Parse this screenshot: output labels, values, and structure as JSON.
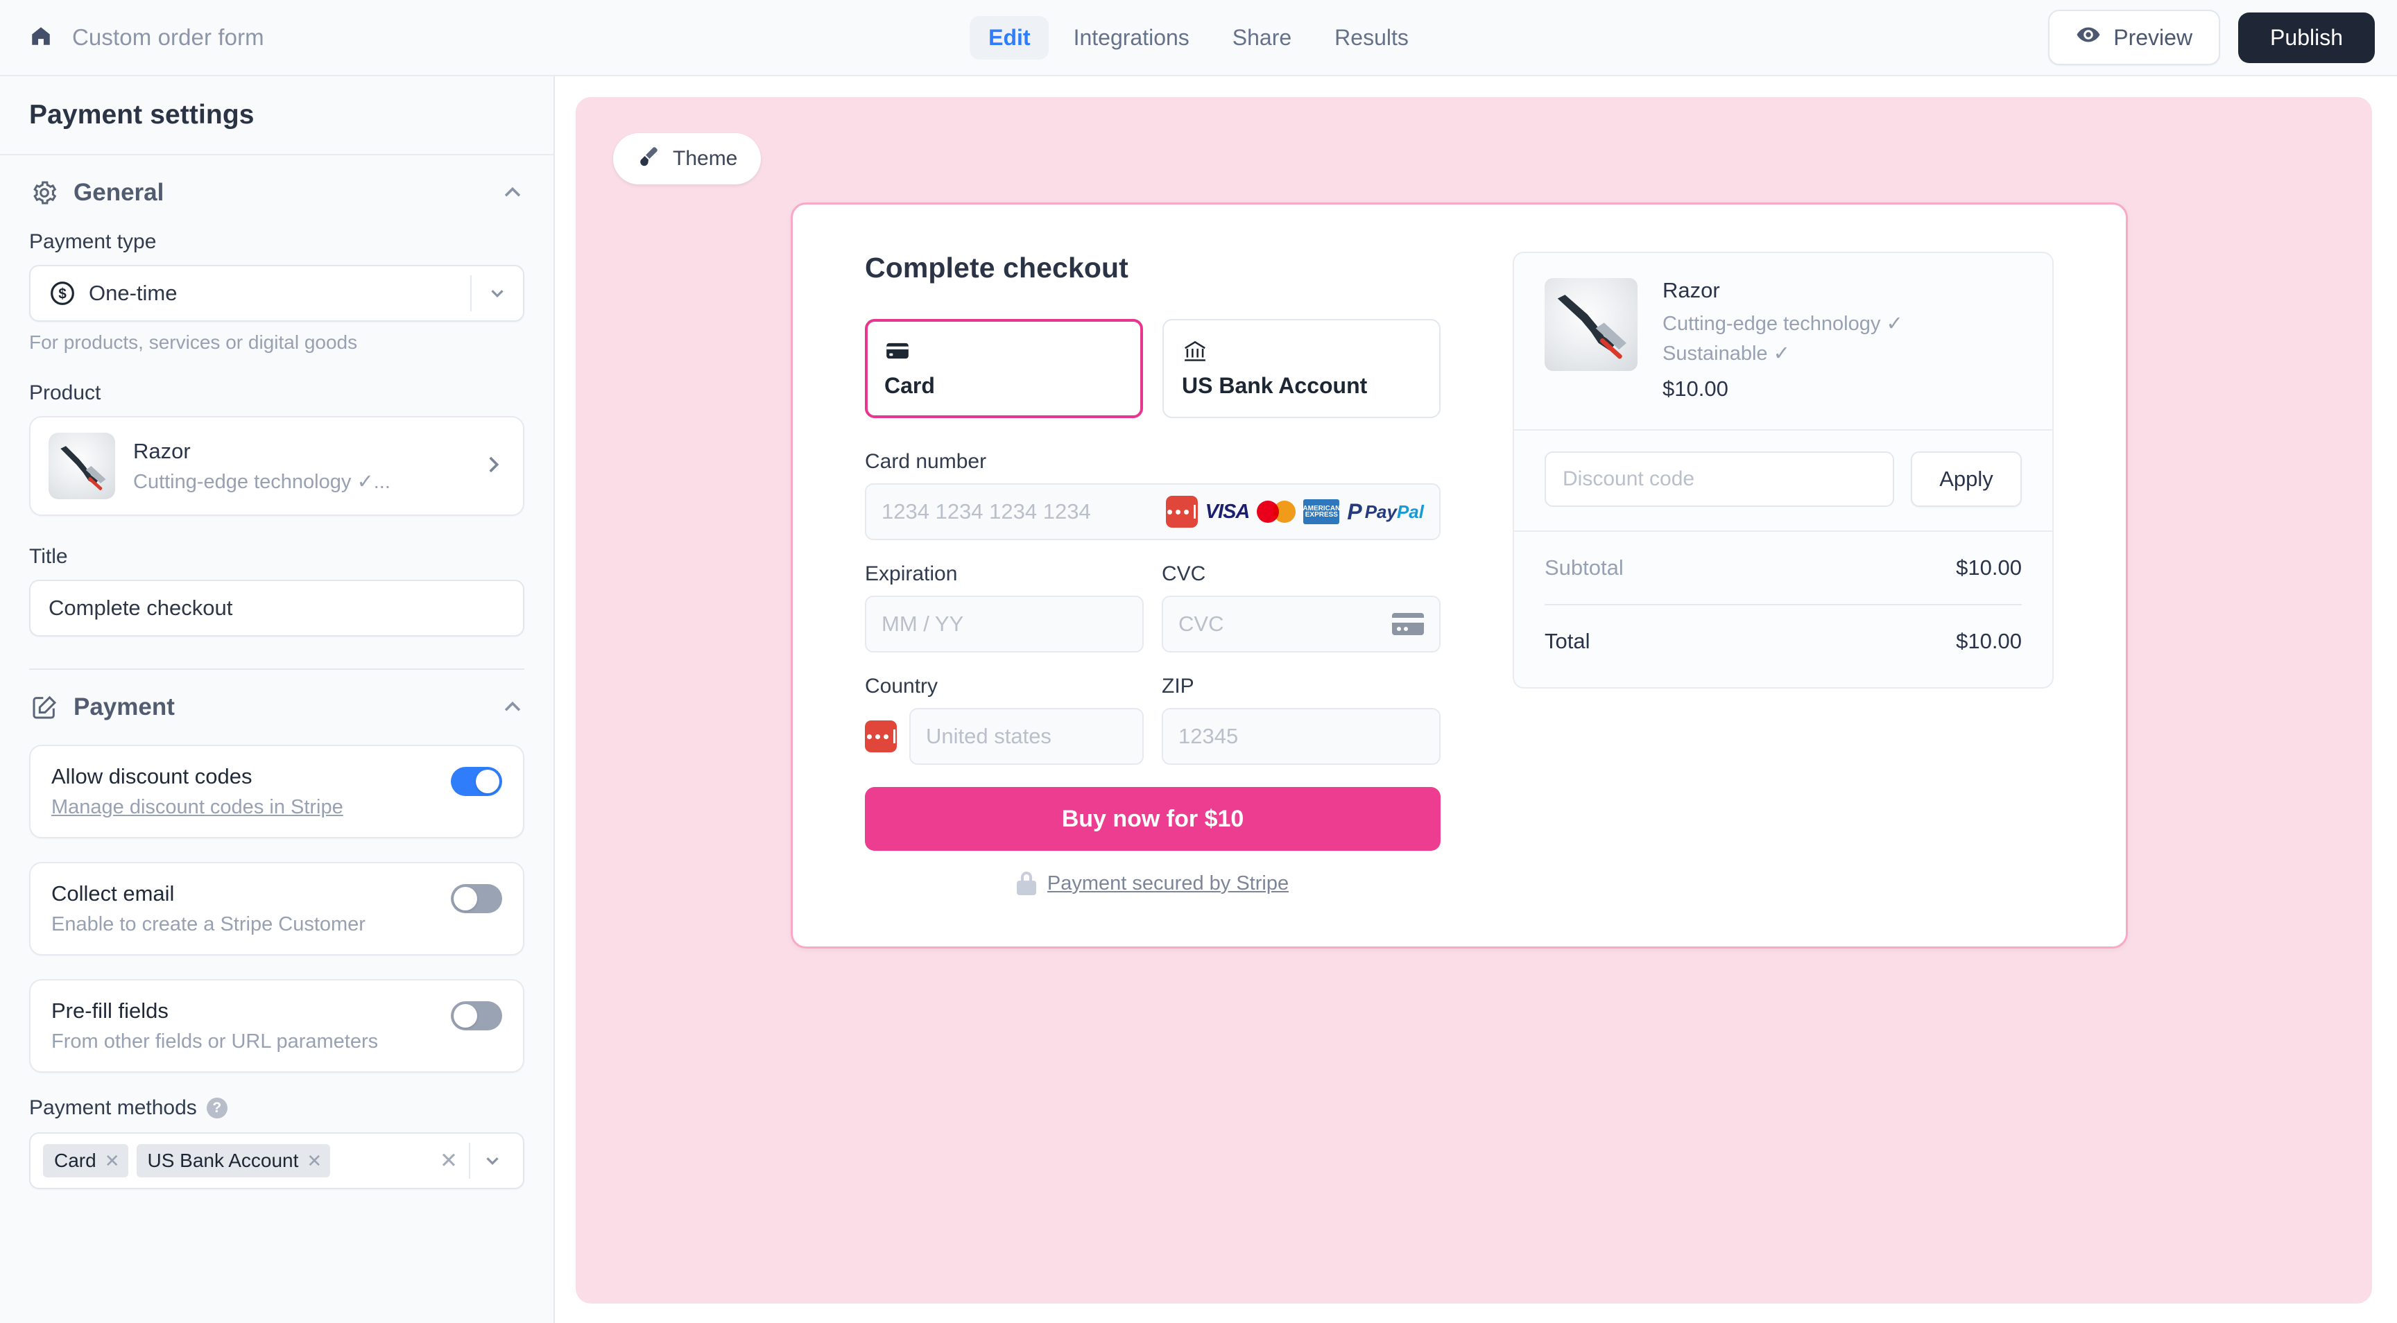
{
  "topbar": {
    "home_icon": "home-icon",
    "doc_title": "Custom order form",
    "tabs": [
      {
        "label": "Edit",
        "active": true
      },
      {
        "label": "Integrations",
        "active": false
      },
      {
        "label": "Share",
        "active": false
      },
      {
        "label": "Results",
        "active": false
      }
    ],
    "preview_label": "Preview",
    "preview_icon": "eye-icon",
    "publish_label": "Publish",
    "accent_blue": "#2f7dfb",
    "publish_bg": "#1f2736"
  },
  "sidebar": {
    "title": "Payment settings",
    "general": {
      "icon": "gear-icon",
      "title": "General",
      "collapse_icon": "chevron-up-icon",
      "payment_type_label": "Payment type",
      "payment_type_value": "One-time",
      "payment_type_icon": "dollar-circle-icon",
      "payment_type_hint": "For products, services or digital goods",
      "product_label": "Product",
      "product_name": "Razor",
      "product_subtitle": "Cutting-edge technology ✓...",
      "title_label": "Title",
      "title_value": "Complete checkout"
    },
    "payment": {
      "icon": "edit-square-icon",
      "title": "Payment",
      "collapse_icon": "chevron-up-icon",
      "toggles": [
        {
          "title": "Allow discount codes",
          "link": "Manage discount codes in Stripe",
          "on": true
        },
        {
          "title": "Collect email",
          "sub": "Enable to create a Stripe Customer",
          "on": false
        },
        {
          "title": "Pre-fill fields",
          "sub": "From other fields or URL parameters",
          "on": false
        }
      ],
      "methods_label": "Payment methods",
      "methods_help_icon": "help-circle-icon",
      "methods_chips": [
        "Card",
        "US Bank Account"
      ],
      "clear_icon": "clear-x-icon",
      "dropdown_icon": "chevron-down-icon"
    }
  },
  "preview": {
    "theme_label": "Theme",
    "theme_icon": "paintbrush-icon",
    "canvas_bg": "#fbdde7",
    "card_border": "#f9a8c8",
    "accent_pink": "#ec3d91",
    "checkout": {
      "title": "Complete checkout",
      "method_tabs": [
        {
          "label": "Card",
          "icon": "credit-card-icon",
          "selected": true
        },
        {
          "label": "US Bank Account",
          "icon": "bank-icon",
          "selected": false
        }
      ],
      "card_number_label": "Card number",
      "card_number_placeholder": "1234 1234 1234 1234",
      "brands": [
        "link-icon",
        "visa-logo",
        "mastercard-logo",
        "amex-logo",
        "paypal-logo"
      ],
      "expiration_label": "Expiration",
      "expiration_placeholder": "MM / YY",
      "cvc_label": "CVC",
      "cvc_placeholder": "CVC",
      "cvc_icon": "cvc-card-icon",
      "country_label": "Country",
      "country_placeholder": "United states",
      "country_badge_icon": "link-icon",
      "zip_label": "ZIP",
      "zip_placeholder": "12345",
      "buy_label": "Buy now for $10",
      "secured_icon": "lock-icon",
      "secured_label": "Payment secured by Stripe"
    },
    "summary": {
      "product_name": "Razor",
      "features": [
        "Cutting-edge technology ✓",
        "Sustainable ✓"
      ],
      "product_price": "$10.00",
      "discount_placeholder": "Discount code",
      "apply_label": "Apply",
      "subtotal_label": "Subtotal",
      "subtotal_value": "$10.00",
      "total_label": "Total",
      "total_value": "$10.00"
    }
  }
}
